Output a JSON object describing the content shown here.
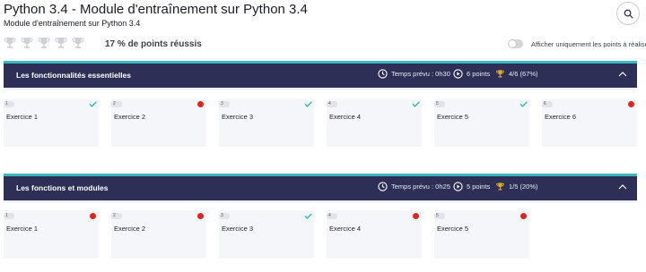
{
  "header": {
    "title": "Python 3.4 - Module d'entraînement sur Python 3.4",
    "subtitle": "Module d'entraînement sur Python 3.4",
    "score_text": "17 % de points réussis",
    "toggle_label": "Afficher uniquement les points à réaliser",
    "toggle_on": false,
    "trophy_count": 5
  },
  "sections": [
    {
      "title": "Les fonctionnalités essentielles",
      "time": "Temps prévu : 0h30",
      "points": "6 points",
      "score": "4/6 (67%)",
      "exercises": [
        {
          "num": "1",
          "label": "Exercice 1",
          "status": "done"
        },
        {
          "num": "2",
          "label": "Exercice 2",
          "status": "todo"
        },
        {
          "num": "3",
          "label": "Exercice 3",
          "status": "done"
        },
        {
          "num": "4",
          "label": "Exercice 4",
          "status": "done"
        },
        {
          "num": "5",
          "label": "Exercice 5",
          "status": "done"
        },
        {
          "num": "6",
          "label": "Exercice 6",
          "status": "todo"
        }
      ]
    },
    {
      "title": "Les fonctions et modules",
      "time": "Temps prévu : 0h25",
      "points": "5 points",
      "score": "1/5 (20%)",
      "exercises": [
        {
          "num": "1",
          "label": "Exercice 1",
          "status": "todo"
        },
        {
          "num": "2",
          "label": "Exercice 2",
          "status": "todo"
        },
        {
          "num": "3",
          "label": "Exercice 3",
          "status": "done"
        },
        {
          "num": "4",
          "label": "Exercice 4",
          "status": "todo"
        },
        {
          "num": "5",
          "label": "Exercice 5",
          "status": "todo"
        }
      ]
    }
  ],
  "icons": {
    "search": "search-icon",
    "trophy": "trophy-icon",
    "clock": "clock-icon",
    "play": "play-circle-icon",
    "score_trophy": "trophy-icon",
    "collapse": "chevron-up-icon",
    "done": "check-icon",
    "todo": "red-dot-icon"
  },
  "colors": {
    "section_bar": "#2e2f56",
    "accent": "#3bb7c0",
    "done": "#2fbfa8",
    "todo": "#e0231f",
    "trophy_gold": "#e2a91f",
    "trophy_inactive": "#cfd1d8"
  }
}
